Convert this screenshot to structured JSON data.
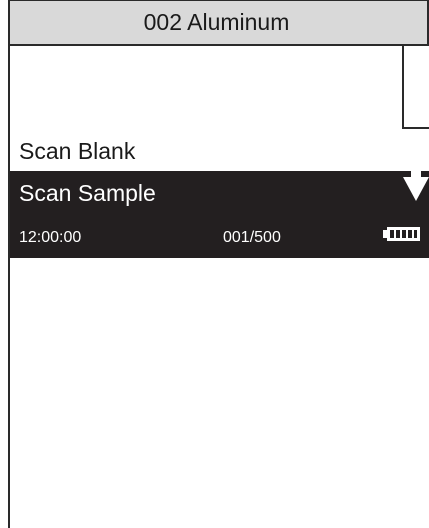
{
  "header": {
    "title": "002 Aluminum"
  },
  "menu": {
    "items": [
      {
        "label": "Scan Blank",
        "selected": false
      },
      {
        "label": "Scan Sample",
        "selected": true
      }
    ]
  },
  "status": {
    "time": "12:00:00",
    "sample_count": "001/500",
    "battery_icon": "battery-full-icon"
  },
  "colors": {
    "title_bar": "#d9d9d9",
    "highlight": "#231f20",
    "border": "#2a2a2a",
    "text_dark": "#1a1a1a",
    "text_light": "#ffffff"
  },
  "icons": {
    "scroll": "down-arrow-icon"
  }
}
